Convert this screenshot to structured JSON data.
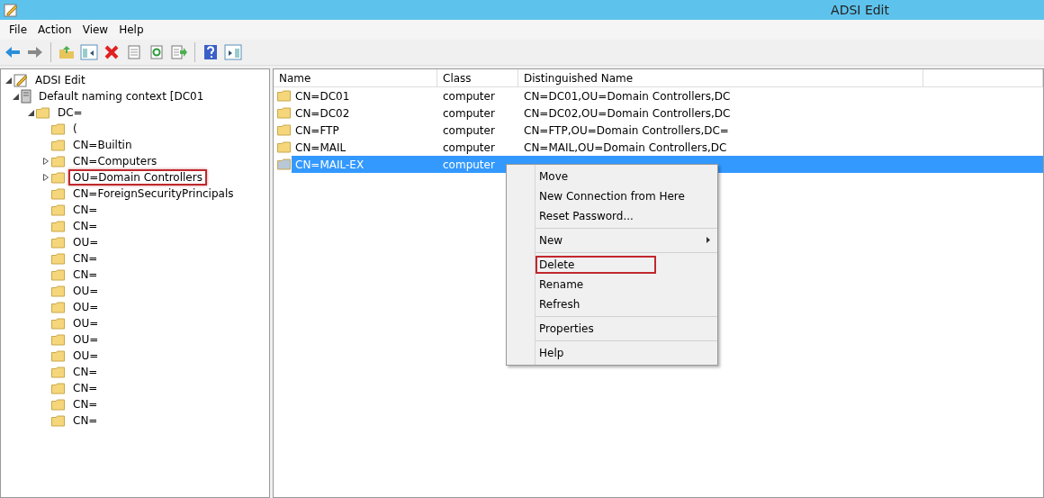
{
  "window": {
    "title": "ADSI Edit"
  },
  "menu_bar": [
    "File",
    "Action",
    "View",
    "Help"
  ],
  "toolbar": [
    {
      "kind": "back"
    },
    {
      "kind": "forward"
    },
    {
      "kind": "separator"
    },
    {
      "kind": "up"
    },
    {
      "kind": "tree"
    },
    {
      "kind": "delete"
    },
    {
      "kind": "properties"
    },
    {
      "kind": "refresh"
    },
    {
      "kind": "export"
    },
    {
      "kind": "separator"
    },
    {
      "kind": "help"
    },
    {
      "kind": "pane"
    }
  ],
  "tree": [
    {
      "label": "ADSI Edit",
      "kind": "root",
      "expanded": true,
      "annotated": false,
      "children": [
        {
          "label": "Default naming context [DC01",
          "kind": "server",
          "expanded": true,
          "annotated": false,
          "children": [
            {
              "label": "DC=",
              "kind": "folder",
              "expanded": true,
              "annotated": false,
              "children": [
                {
                  "label": "(",
                  "kind": "folder",
                  "expandable": false,
                  "annotated": false
                },
                {
                  "label": "CN=Builtin",
                  "kind": "folder",
                  "expandable": false,
                  "annotated": false
                },
                {
                  "label": "CN=Computers",
                  "kind": "folder",
                  "expandable": true,
                  "annotated": false
                },
                {
                  "label": "OU=Domain Controllers",
                  "kind": "folder",
                  "expandable": true,
                  "annotated": true
                },
                {
                  "label": "CN=ForeignSecurityPrincipals",
                  "kind": "folder",
                  "expandable": false,
                  "annotated": false
                },
                {
                  "label": "CN=",
                  "kind": "folder",
                  "expandable": false,
                  "annotated": false
                },
                {
                  "label": "CN=",
                  "kind": "folder",
                  "expandable": false,
                  "annotated": false
                },
                {
                  "label": "OU=",
                  "kind": "folder",
                  "expandable": false,
                  "annotated": false
                },
                {
                  "label": "CN=",
                  "kind": "folder",
                  "expandable": false,
                  "annotated": false
                },
                {
                  "label": "CN=",
                  "kind": "folder",
                  "expandable": false,
                  "annotated": false
                },
                {
                  "label": "OU=",
                  "kind": "folder",
                  "expandable": false,
                  "annotated": false
                },
                {
                  "label": "OU=",
                  "kind": "folder",
                  "expandable": false,
                  "annotated": false
                },
                {
                  "label": "OU=",
                  "kind": "folder",
                  "expandable": false,
                  "annotated": false
                },
                {
                  "label": "OU=",
                  "kind": "folder",
                  "expandable": false,
                  "annotated": false
                },
                {
                  "label": "OU=",
                  "kind": "folder",
                  "expandable": false,
                  "annotated": false
                },
                {
                  "label": "CN=",
                  "kind": "folder",
                  "expandable": false,
                  "annotated": false
                },
                {
                  "label": "CN=",
                  "kind": "folder",
                  "expandable": false,
                  "annotated": false
                },
                {
                  "label": "CN=",
                  "kind": "folder",
                  "expandable": false,
                  "annotated": false
                },
                {
                  "label": "CN=",
                  "kind": "folder",
                  "expandable": false,
                  "annotated": false
                }
              ]
            }
          ]
        }
      ]
    }
  ],
  "table": {
    "columns": [
      "Name",
      "Class",
      "Distinguished Name"
    ],
    "rows": [
      {
        "name": "CN=DC01",
        "class": "computer",
        "dn": "CN=DC01,OU=Domain Controllers,DC",
        "selected": false
      },
      {
        "name": "CN=DC02",
        "class": "computer",
        "dn": "CN=DC02,OU=Domain Controllers,DC",
        "selected": false
      },
      {
        "name": "CN=FTP",
        "class": "computer",
        "dn": "CN=FTP,OU=Domain Controllers,DC=",
        "selected": false
      },
      {
        "name": "CN=MAIL",
        "class": "computer",
        "dn": "CN=MAIL,OU=Domain Controllers,DC",
        "selected": false
      },
      {
        "name": "CN=MAIL-EX",
        "class": "computer",
        "selected": true
      }
    ]
  },
  "context_menu": [
    {
      "kind": "item",
      "label": "Move",
      "annotated": false
    },
    {
      "kind": "item",
      "label": "New Connection from Here",
      "annotated": false
    },
    {
      "kind": "item",
      "label": "Reset Password...",
      "annotated": false
    },
    {
      "kind": "separator"
    },
    {
      "kind": "submenu",
      "label": "New"
    },
    {
      "kind": "separator"
    },
    {
      "kind": "item",
      "label": "Delete",
      "annotated": true
    },
    {
      "kind": "item",
      "label": "Rename",
      "annotated": false
    },
    {
      "kind": "item",
      "label": "Refresh",
      "annotated": false
    },
    {
      "kind": "separator"
    },
    {
      "kind": "item",
      "label": "Properties",
      "annotated": false
    },
    {
      "kind": "separator"
    },
    {
      "kind": "item",
      "label": "Help",
      "annotated": false
    }
  ]
}
